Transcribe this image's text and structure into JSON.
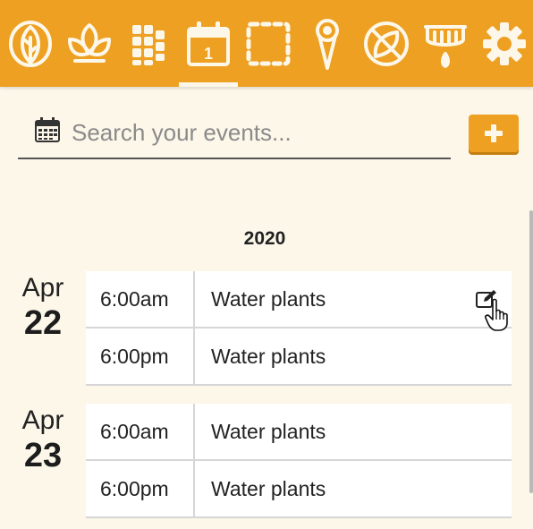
{
  "colors": {
    "accent": "#eda021",
    "background": "#fdf7ea",
    "icon": "#fdf7ea"
  },
  "nav": {
    "items": [
      {
        "icon": "leaf-icon"
      },
      {
        "icon": "plants-icon"
      },
      {
        "icon": "grid-icon"
      },
      {
        "icon": "calendar-icon",
        "active": true,
        "day": "1"
      },
      {
        "icon": "dashed-square-icon"
      },
      {
        "icon": "probe-icon"
      },
      {
        "icon": "no-leaf-icon"
      },
      {
        "icon": "sprinkler-icon"
      },
      {
        "icon": "gear-icon"
      }
    ]
  },
  "search": {
    "placeholder": "Search your events...",
    "value": ""
  },
  "add_button": {
    "icon": "plus-icon"
  },
  "events": {
    "year": "2020",
    "days": [
      {
        "month": "Apr",
        "day": "22",
        "items": [
          {
            "time": "6:00am",
            "name": "Water plants"
          },
          {
            "time": "6:00pm",
            "name": "Water plants"
          }
        ]
      },
      {
        "month": "Apr",
        "day": "23",
        "items": [
          {
            "time": "6:00am",
            "name": "Water plants"
          },
          {
            "time": "6:00pm",
            "name": "Water plants"
          }
        ]
      }
    ]
  }
}
